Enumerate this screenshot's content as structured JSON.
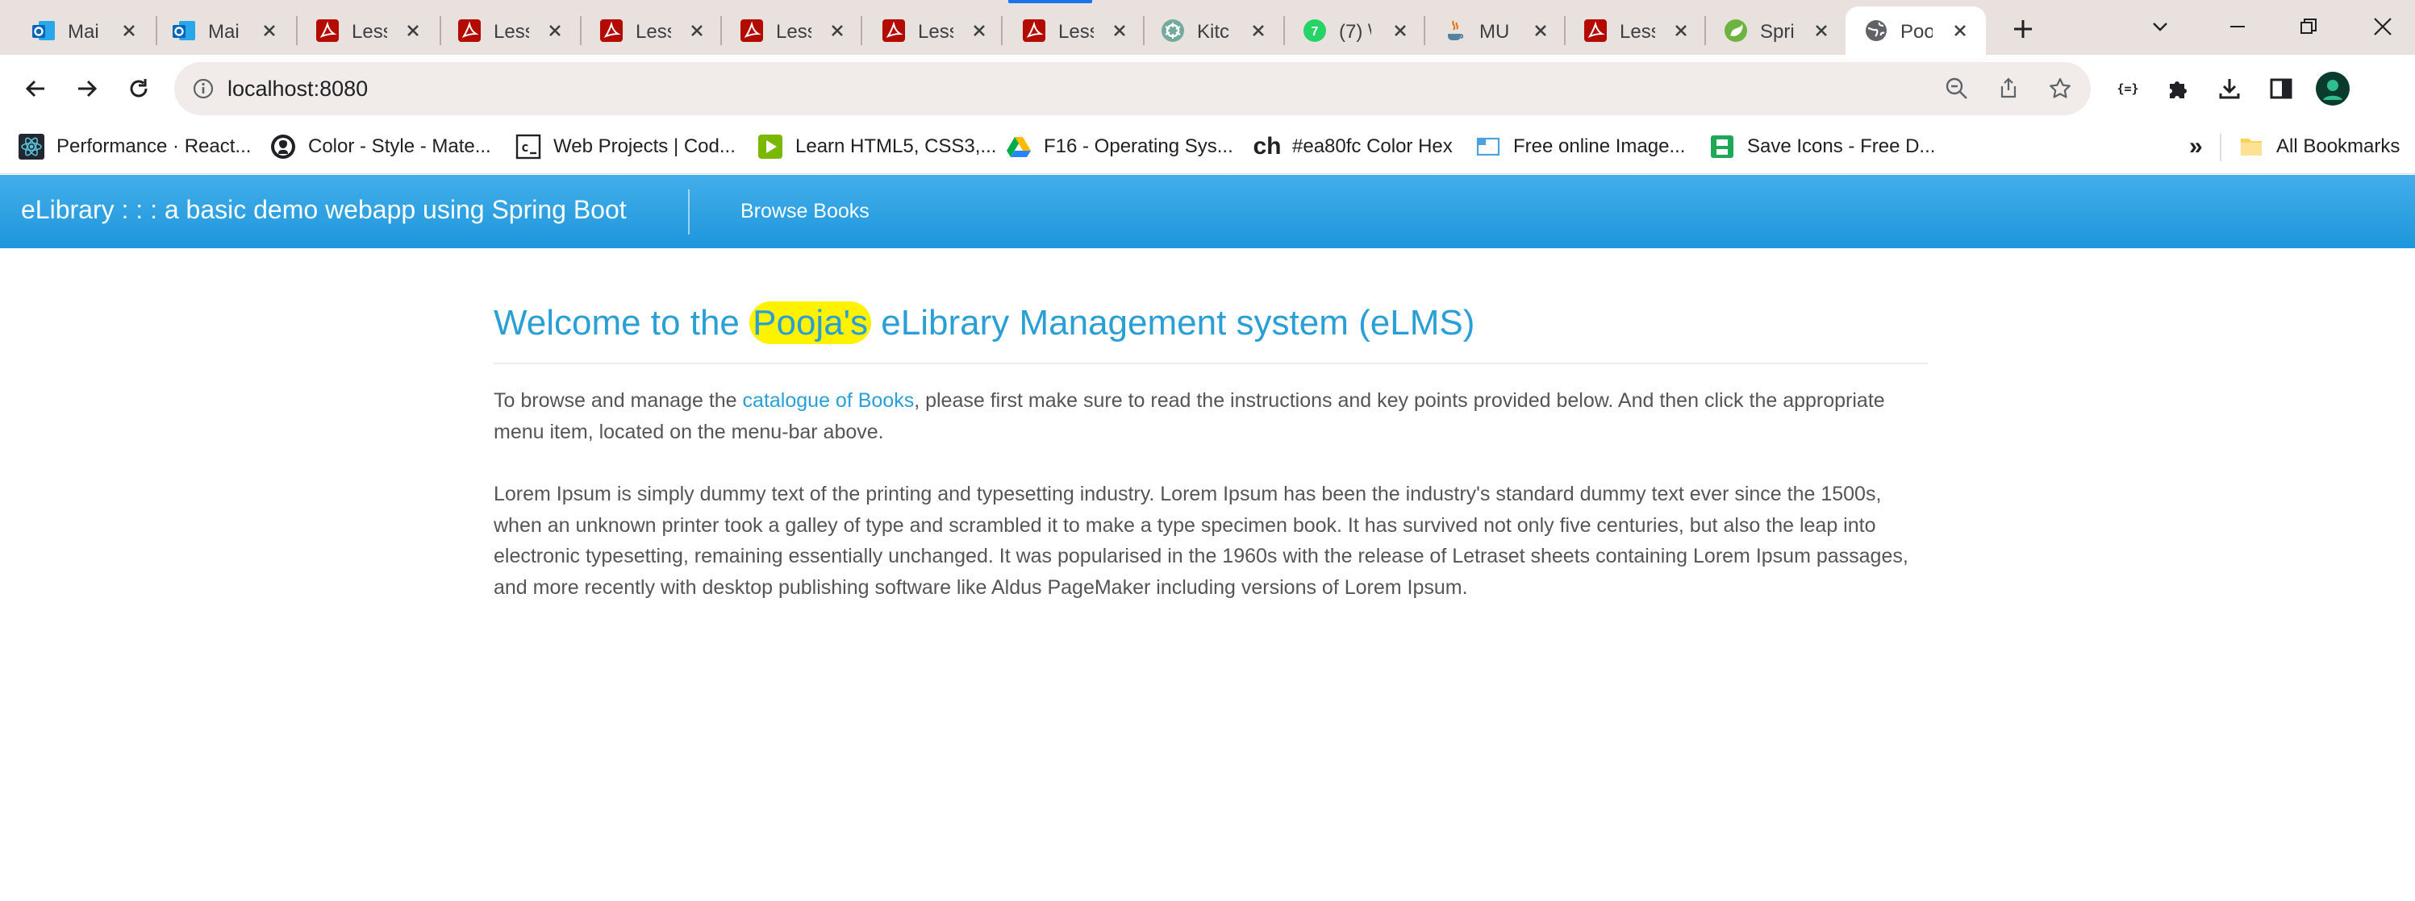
{
  "browser": {
    "tabs": [
      {
        "title": "Mai",
        "icon": "outlook-icon"
      },
      {
        "title": "Mai",
        "icon": "outlook-icon"
      },
      {
        "title": "Less",
        "icon": "pdf-icon"
      },
      {
        "title": "Less",
        "icon": "pdf-icon"
      },
      {
        "title": "Less",
        "icon": "pdf-icon"
      },
      {
        "title": "Less",
        "icon": "pdf-icon"
      },
      {
        "title": "Less",
        "icon": "pdf-icon"
      },
      {
        "title": "Less",
        "icon": "pdf-icon"
      },
      {
        "title": "Kitc",
        "icon": "chatgpt-icon"
      },
      {
        "title": "(7) \\",
        "icon": "whatsapp-icon"
      },
      {
        "title": "MU",
        "icon": "java-icon"
      },
      {
        "title": "Less",
        "icon": "pdf-icon"
      },
      {
        "title": "Spri",
        "icon": "spring-icon"
      },
      {
        "title": "Poo",
        "icon": "globe-icon",
        "active": true
      }
    ],
    "url": "localhost:8080",
    "bookmarks": [
      {
        "label": "Performance · React...",
        "icon": "react-icon"
      },
      {
        "label": "Color - Style - Mate...",
        "icon": "github-icon"
      },
      {
        "label": "Web Projects | Cod...",
        "icon": "codepen-icon"
      },
      {
        "label": "Learn HTML5, CSS3,...",
        "icon": "play-icon"
      },
      {
        "label": "F16 - Operating Sys...",
        "icon": "drive-icon"
      },
      {
        "label": "#ea80fc Color Hex",
        "icon": "ch-icon"
      },
      {
        "label": "Free online Image...",
        "icon": "image-icon"
      },
      {
        "label": "Save Icons - Free D...",
        "icon": "save-icon"
      }
    ],
    "bookmarks_overflow": "»",
    "all_bookmarks": "All Bookmarks",
    "ch_glyph": "ch"
  },
  "navbar": {
    "brand": "eLibrary : : : a basic demo webapp using Spring Boot",
    "links": [
      "Browse Books"
    ]
  },
  "main": {
    "title_before": "Welcome to the",
    "title_highlight": "Pooja's",
    "title_after": "eLibrary Management system (eLMS)",
    "intro_before": "To browse and manage the",
    "intro_link": "catalogue of Books",
    "intro_after": ", please first make sure to read the instructions and key points provided below. And then click the appropriate menu item, located on the menu-bar above.",
    "lorem": "Lorem Ipsum is simply dummy text of the printing and typesetting industry. Lorem Ipsum has been the industry's standard dummy text ever since the 1500s, when an unknown printer took a galley of type and scrambled it to make a type specimen book. It has survived not only five centuries, but also the leap into electronic typesetting, remaining essentially unchanged. It was popularised in the 1960s with the release of Letraset sheets containing Lorem Ipsum passages, and more recently with desktop publishing software like Aldus PageMaker including versions of Lorem Ipsum."
  },
  "colors": {
    "navbar": "#2a9fd6",
    "title": "#2a9fd6",
    "highlight": "#fff200",
    "body_text": "#555555",
    "link": "#2a9fd6"
  }
}
